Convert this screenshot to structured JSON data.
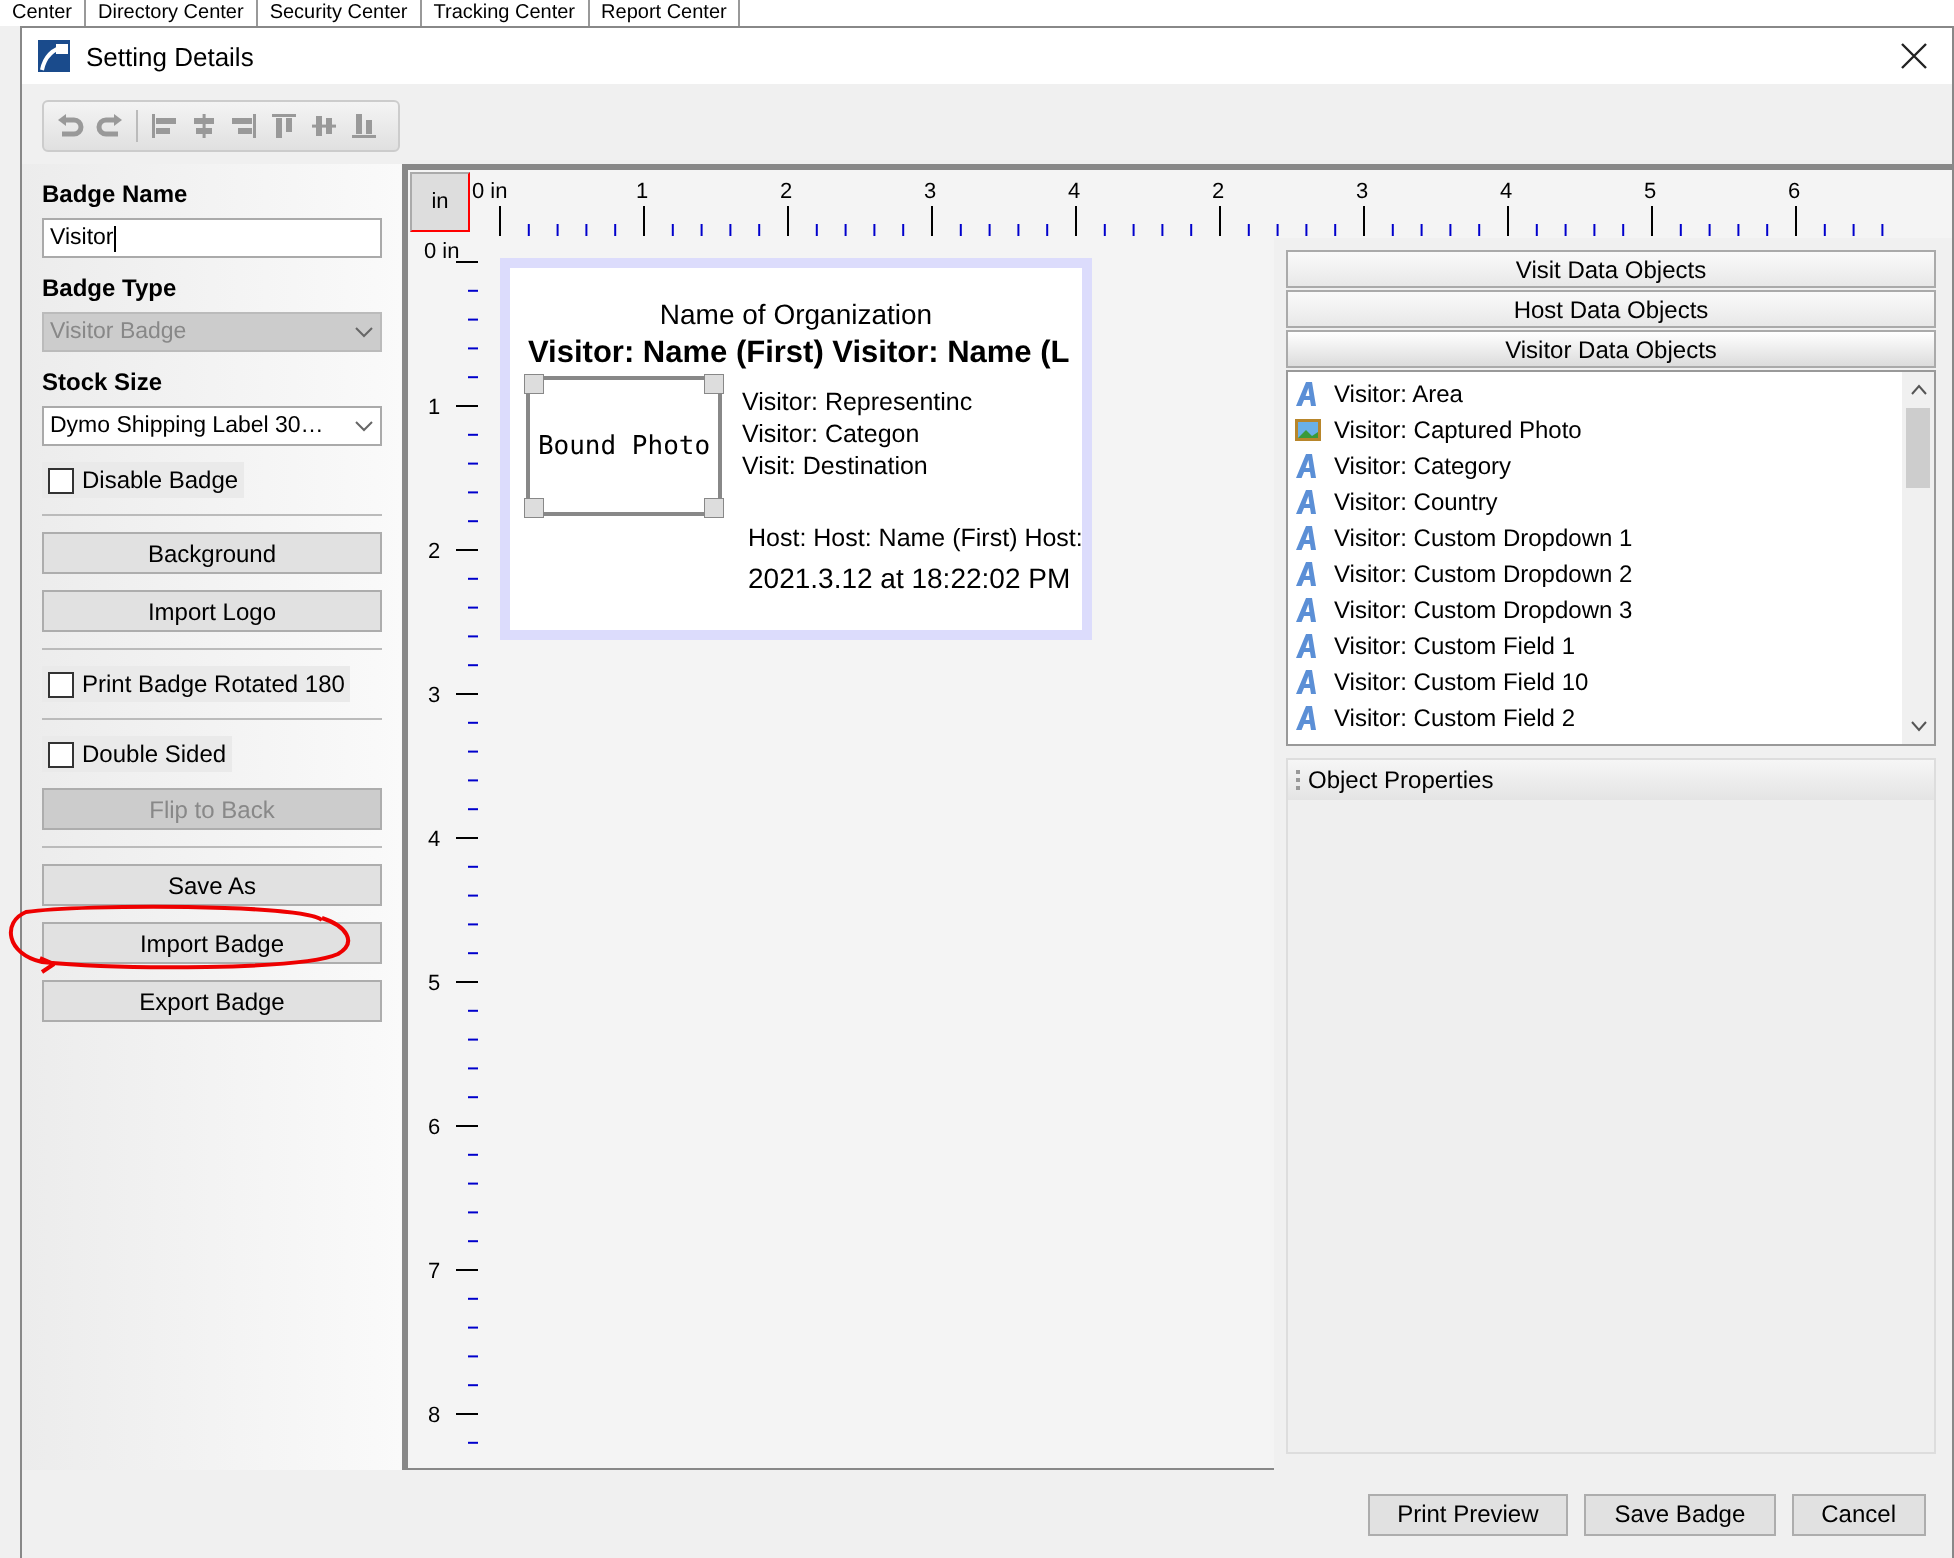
{
  "background_tabs": [
    "Center",
    "Directory Center",
    "Security Center",
    "Tracking Center",
    "Report Center"
  ],
  "window": {
    "title": "Setting Details"
  },
  "left_panel": {
    "badge_name": {
      "label": "Badge Name",
      "value": "Visitor"
    },
    "badge_type": {
      "label": "Badge Type",
      "value": "Visitor Badge",
      "disabled": true
    },
    "stock_size": {
      "label": "Stock Size",
      "value": "Dymo Shipping Label 30…",
      "disabled": false
    },
    "groups": [
      [
        {
          "kind": "checkbox",
          "label": "Disable Badge",
          "checked": false
        }
      ],
      [
        {
          "kind": "button",
          "label": "Background",
          "disabled": false
        },
        {
          "kind": "button",
          "label": "Import Logo",
          "disabled": false
        }
      ],
      [
        {
          "kind": "checkbox",
          "label": "Print Badge Rotated 180",
          "checked": false
        }
      ],
      [
        {
          "kind": "checkbox",
          "label": "Double Sided",
          "checked": false
        },
        {
          "kind": "button",
          "label": "Flip to Back",
          "disabled": true
        }
      ],
      [
        {
          "kind": "button",
          "label": "Save As",
          "disabled": false
        },
        {
          "kind": "button",
          "label": "Import Badge",
          "disabled": false,
          "circled": true
        },
        {
          "kind": "button",
          "label": "Export Badge",
          "disabled": false
        }
      ]
    ]
  },
  "ruler": {
    "unit_button": "in",
    "horizontal_labels": [
      "0 in",
      "1",
      "2",
      "3",
      "4",
      "2",
      "3",
      "4",
      "5",
      "6"
    ],
    "vertical_labels": [
      "0 in",
      "1",
      "2",
      "3",
      "4",
      "5",
      "6",
      "7",
      "8"
    ]
  },
  "badge": {
    "organization": "Name of Organization",
    "visitor_name": "Visitor: Name (First) Visitor: Name (L",
    "photo_label": "Bound Photo",
    "fields": [
      "Visitor: Representinc",
      "Visitor: Categon",
      "Visit: Destination"
    ],
    "host": "Host:  Host: Name (First) Host:",
    "timestamp": "2021.3.12 at 18:22:02 PM"
  },
  "right_panel": {
    "sections": [
      {
        "label": "Visit Data Objects",
        "expanded": false
      },
      {
        "label": "Host Data Objects",
        "expanded": false
      },
      {
        "label": "Visitor Data Objects",
        "expanded": true
      }
    ],
    "items": [
      {
        "kind": "text",
        "label": "Visitor: Area"
      },
      {
        "kind": "photo",
        "label": "Visitor: Captured Photo"
      },
      {
        "kind": "text",
        "label": "Visitor: Category"
      },
      {
        "kind": "text",
        "label": "Visitor: Country"
      },
      {
        "kind": "text",
        "label": "Visitor: Custom Dropdown 1"
      },
      {
        "kind": "text",
        "label": "Visitor: Custom Dropdown 2"
      },
      {
        "kind": "text",
        "label": "Visitor: Custom Dropdown 3"
      },
      {
        "kind": "text",
        "label": "Visitor: Custom Field 1"
      },
      {
        "kind": "text",
        "label": "Visitor: Custom Field 10"
      },
      {
        "kind": "text",
        "label": "Visitor: Custom Field 2"
      }
    ],
    "properties_title": "Object Properties"
  },
  "footer_buttons": [
    "Print Preview",
    "Save Badge",
    "Cancel"
  ]
}
